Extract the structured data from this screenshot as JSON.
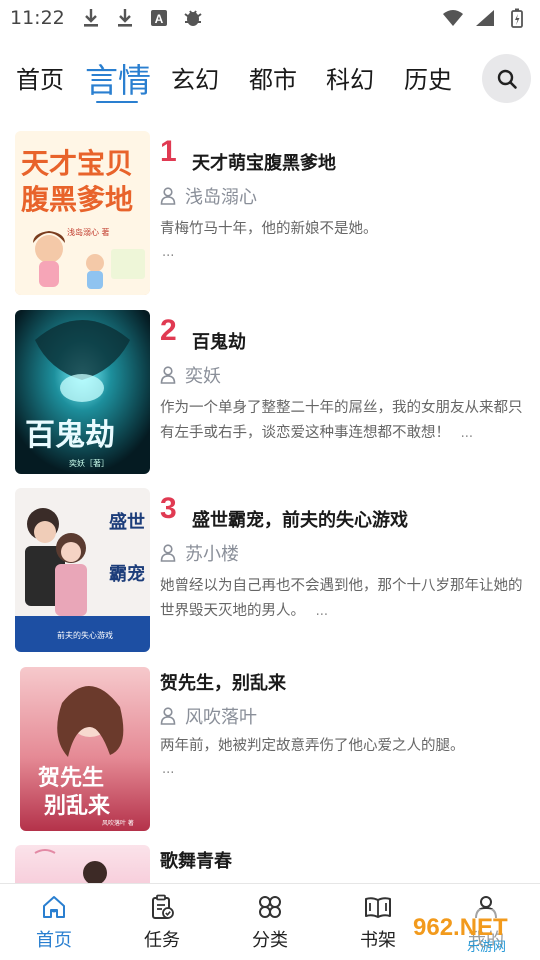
{
  "status_bar": {
    "time": "11:22",
    "left_icons": [
      "download-icon",
      "download-icon",
      "a-icon",
      "bug-icon"
    ],
    "right_icons": [
      "wifi-icon",
      "signal-icon",
      "battery-icon"
    ]
  },
  "tabs": [
    {
      "label": "首页",
      "active": false
    },
    {
      "label": "言情",
      "active": true
    },
    {
      "label": "玄幻",
      "active": false
    },
    {
      "label": "都市",
      "active": false
    },
    {
      "label": "科幻",
      "active": false
    },
    {
      "label": "历史",
      "active": false
    }
  ],
  "search": {
    "icon": "search-icon"
  },
  "books": [
    {
      "rank": "1",
      "title": "天才萌宝腹黑爹地",
      "author": "浅岛溺心",
      "desc": "青梅竹马十年，他的新娘不是她。",
      "more": "...",
      "cover_text": [
        "天才宝贝",
        "腹黑爹地"
      ],
      "cover_sub": "浅岛溺心 著"
    },
    {
      "rank": "2",
      "title": "百鬼劫",
      "author": "奕妖",
      "desc": "作为一个单身了整整二十年的屌丝，我的女朋友从来都只有左手或右手，谈恋爱这种事连想都不敢想！",
      "more": "...",
      "cover_text": [
        "百鬼劫"
      ],
      "cover_sub": "奕妖［著］"
    },
    {
      "rank": "3",
      "title": "盛世霸宠，前夫的失心游戏",
      "author": "苏小楼",
      "desc": "她曾经以为自己再也不会遇到他，那个十八岁那年让她的世界毁天灭地的男人。",
      "more": "...",
      "cover_text": [
        "盛世",
        "霸宠"
      ],
      "cover_sub": "前夫的失心游戏"
    },
    {
      "rank": "",
      "title": "贺先生，别乱来",
      "author": "风吹落叶",
      "desc": "两年前，她被判定故意弄伤了他心爱之人的腿。",
      "more": "...",
      "cover_text": [
        "贺先生",
        "别乱来"
      ],
      "cover_sub": "风吹落叶 著"
    },
    {
      "rank": "",
      "title": "歌舞青春",
      "author": "",
      "desc": "",
      "more": ""
    }
  ],
  "bottom_nav": [
    {
      "label": "首页",
      "icon": "home-icon",
      "active": true
    },
    {
      "label": "任务",
      "icon": "task-icon",
      "active": false
    },
    {
      "label": "分类",
      "icon": "category-icon",
      "active": false
    },
    {
      "label": "书架",
      "icon": "bookshelf-icon",
      "active": false
    },
    {
      "label": "我的",
      "icon": "profile-icon",
      "active": false
    }
  ],
  "watermark": {
    "brand": "962.NET",
    "sub": "乐游网"
  },
  "colors": {
    "accent": "#2a7fd0",
    "rank": "#e03a52",
    "muted": "#8a8f99"
  }
}
